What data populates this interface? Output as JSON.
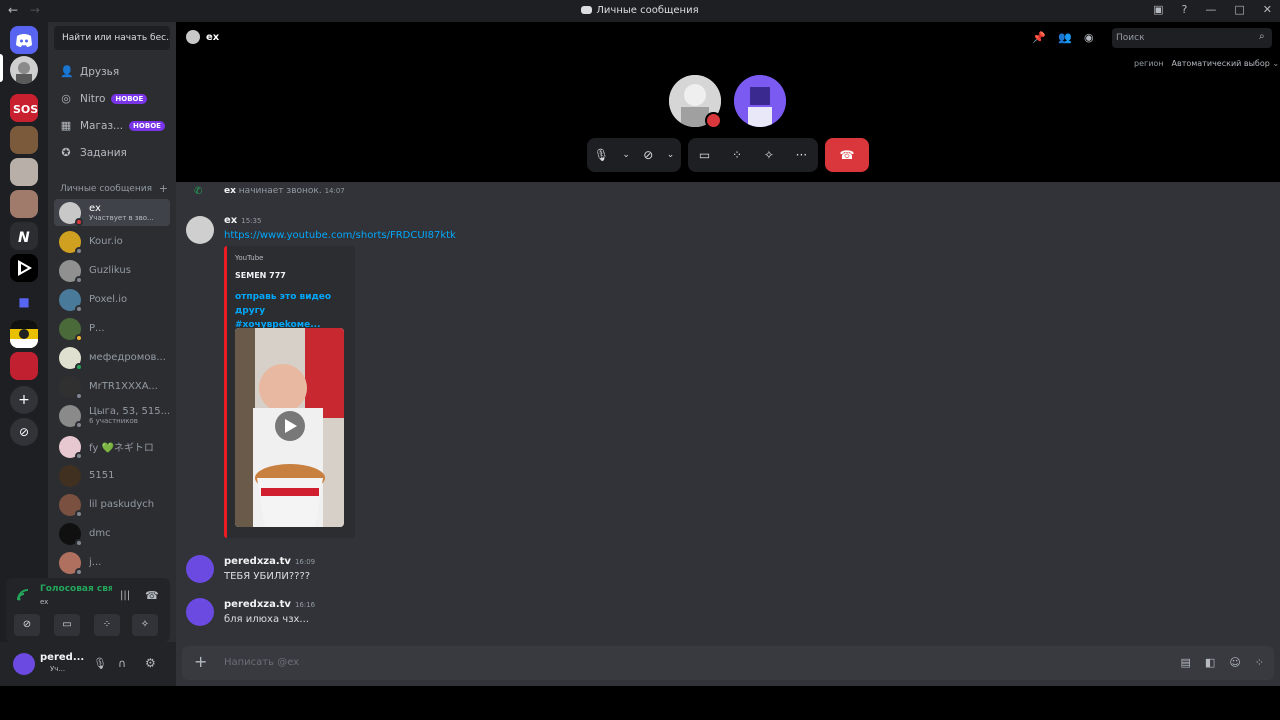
{
  "window": {
    "title": "Личные сообщения",
    "nav_back": "←",
    "nav_forward": "→"
  },
  "sidebar": {
    "search_label": "Найти или начать бес...",
    "nav": [
      {
        "label": "Друзья",
        "icon": "friends-icon"
      },
      {
        "label": "Nitro",
        "badge": "НОВОЕ",
        "icon": "nitro-icon"
      },
      {
        "label": "Магаз...",
        "badge": "НОВОЕ",
        "icon": "shop-icon"
      },
      {
        "label": "Задания",
        "icon": "quests-icon"
      }
    ],
    "dm_header": "Личные сообщения",
    "dm_add": "+",
    "dms": [
      {
        "name": "ex",
        "sub": "Участвует в зво..."
      },
      {
        "name": "Kour.io"
      },
      {
        "name": "Guzlikus"
      },
      {
        "name": "Poxel.io"
      },
      {
        "name": "Р..."
      },
      {
        "name": "мефедромов..."
      },
      {
        "name": "MrTR1XXXA..."
      },
      {
        "name": "Цыга, 53, 515...",
        "sub": "6 участников"
      },
      {
        "name": "fy 💚ネギトロ"
      },
      {
        "name": "5151"
      },
      {
        "name": "lil paskudych"
      },
      {
        "name": "dmc"
      },
      {
        "name": "j..."
      }
    ],
    "voice": {
      "status": "Голосовая связь",
      "channel": "ex"
    },
    "user": {
      "name": "pered...",
      "status": "Уч..."
    }
  },
  "call": {
    "title": "ex",
    "search_placeholder": "Поиск",
    "region_label": "регион",
    "region_value": "Автоматический выбор"
  },
  "messages": {
    "system": {
      "author": "ex",
      "text": "начинает звонок.",
      "time": "14:07"
    },
    "items": [
      {
        "author": "ex",
        "time": "15:35",
        "text": "https://www.youtube.com/shorts/FRDCUI87ktk"
      },
      {
        "author": "peredxza.tv",
        "time": "16:09",
        "text": "ТЕБЯ УБИЛИ????"
      },
      {
        "author": "peredxza.tv",
        "time": "16:16",
        "text": "бля илюха чзх..."
      }
    ],
    "embed": {
      "provider": "YouTube",
      "author": "SEMEN 777",
      "title": "отправь это видео другу #хочувреkoме..."
    }
  },
  "composer": {
    "placeholder": "Написать @ex"
  },
  "colors": {
    "accent": "#5865f2",
    "danger": "#da373c",
    "online": "#23a55a",
    "link": "#00a8fc"
  }
}
